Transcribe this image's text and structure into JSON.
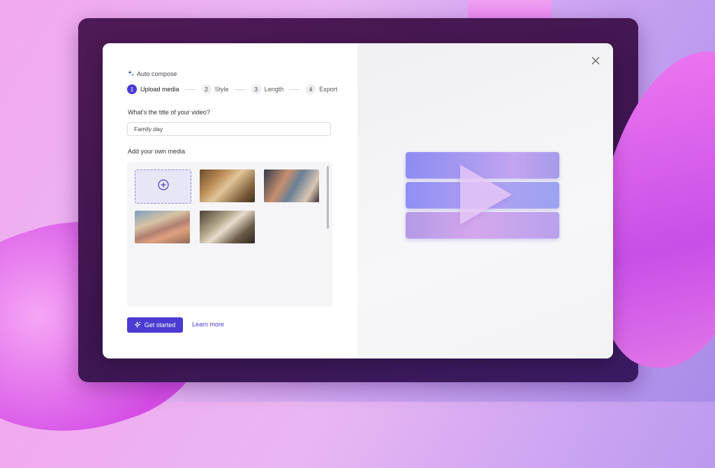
{
  "dialog": {
    "feature_label": "Auto compose",
    "steps": [
      {
        "num": "1",
        "label": "Upload media"
      },
      {
        "num": "2",
        "label": "Style"
      },
      {
        "num": "3",
        "label": "Length"
      },
      {
        "num": "4",
        "label": "Export"
      }
    ],
    "title_question": "What's the title of your video?",
    "title_value": "Family day",
    "media_label": "Add your own media",
    "get_started": "Get started",
    "learn_more": "Learn more"
  },
  "colors": {
    "accent": "#4b3bd3"
  },
  "icons": {
    "feature": "sparkle-icon",
    "close": "close-icon",
    "add": "plus-circle-icon",
    "preview": "play-icon"
  }
}
